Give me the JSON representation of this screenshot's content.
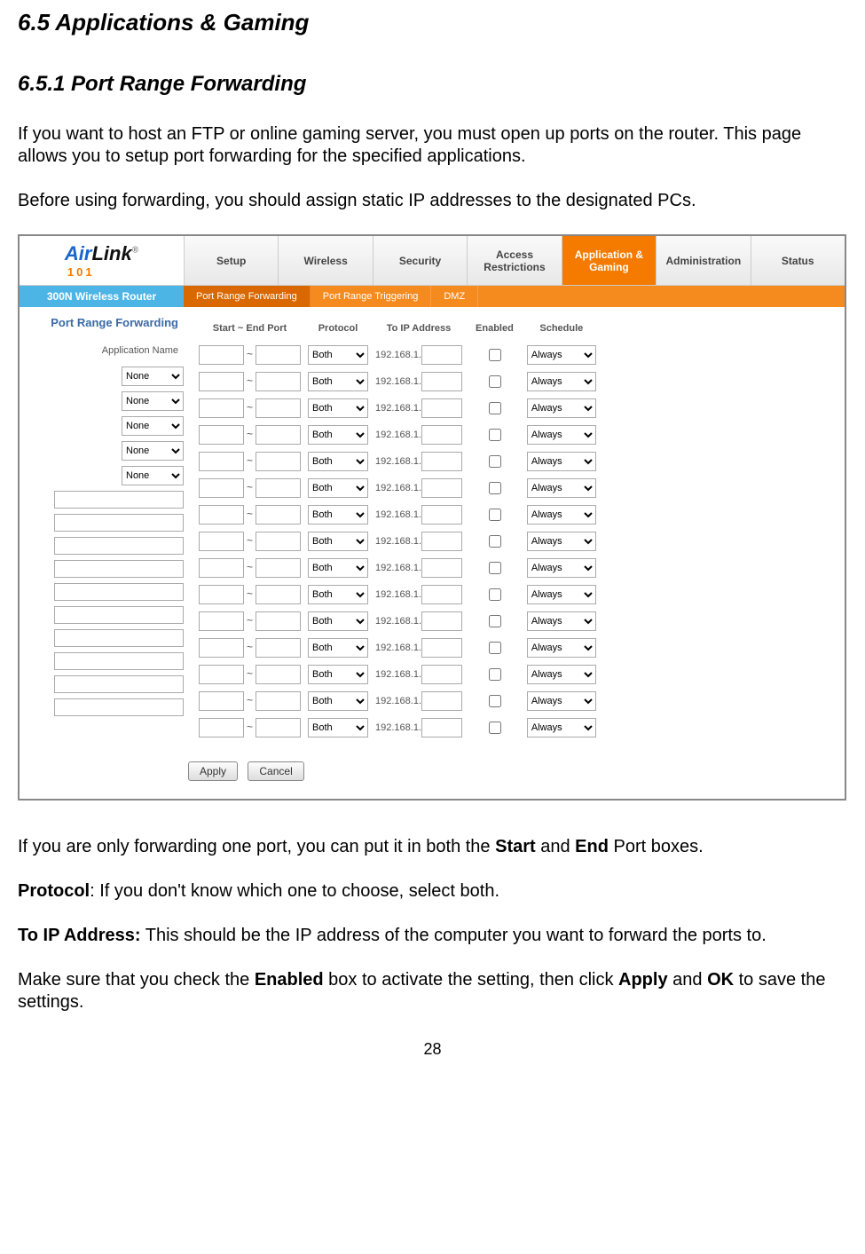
{
  "doc": {
    "heading": "6.5 Applications & Gaming",
    "subheading": "6.5.1 Port Range Forwarding",
    "para1": "If you want to host an FTP or online gaming server, you must open up ports on the router.  This page allows you to setup port forwarding for the specified applications.",
    "para2": "Before using forwarding, you should assign static IP addresses to the designated PCs.",
    "para3a": "If you are only forwarding one port, you can put it in both the ",
    "para3_start": "Start",
    "para3b": " and ",
    "para3_end": "End",
    "para3c": " Port boxes.",
    "para4_label": "Protocol",
    "para4_text": ":  If you don't know which one to choose, select both.",
    "para5_label": "To IP Address:",
    "para5_text": "  This should be the IP address of the computer you want to forward the ports to.",
    "para6a": "Make sure that you check the ",
    "para6_enabled": "Enabled",
    "para6b": " box to activate the setting, then click ",
    "para6_apply": "Apply",
    "para6c": " and ",
    "para6_ok": "OK",
    "para6d": " to save the settings.",
    "page_number": "28"
  },
  "router": {
    "logo_air": "Air",
    "logo_link": "Link",
    "logo_reg": "®",
    "logo_sub": "101",
    "model": "300N Wireless Router",
    "main_tabs": [
      "Setup",
      "Wireless",
      "Security",
      "Access Restrictions",
      "Application & Gaming",
      "Administration",
      "Status"
    ],
    "active_main_tab": 4,
    "sub_tabs": [
      "Port Range Forwarding",
      "Port Range Triggering",
      "DMZ"
    ],
    "active_sub_tab": 0,
    "panel_title": "Port Range Forwarding",
    "app_name_label": "Application Name",
    "cols": {
      "port": "Start ~ End Port",
      "proto": "Protocol",
      "ip": "To IP Address",
      "enabled": "Enabled",
      "schedule": "Schedule"
    },
    "select_row_count": 5,
    "text_row_count": 10,
    "app_select_value": "None",
    "proto_value": "Both",
    "ip_prefix": "192.168.1.",
    "schedule_value": "Always",
    "apply_btn": "Apply",
    "cancel_btn": "Cancel"
  }
}
